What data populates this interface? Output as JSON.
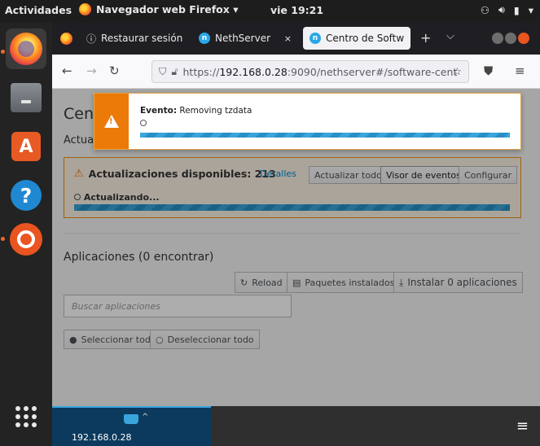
{
  "topbar": {
    "activities": "Actividades",
    "app_menu": "Navegador web Firefox ▾",
    "clock": "vie 19:21",
    "tray_icons": [
      "network-icon",
      "volume-icon",
      "battery-icon",
      "system-menu-chevron-icon"
    ]
  },
  "dock": {
    "apps": [
      "firefox",
      "files",
      "software-store",
      "help",
      "ubuntu-settings"
    ],
    "show_apps": "show-applications-grid-icon"
  },
  "browser": {
    "tabs": [
      {
        "label": "Restaurar sesión",
        "close": "×",
        "icon": "info-icon"
      },
      {
        "label": "NethServer",
        "close": "×",
        "icon": "nethserver-icon"
      },
      {
        "label": "Centro de Softw",
        "close": "×",
        "icon": "nethserver-icon"
      }
    ],
    "new_tab": "+",
    "list_tabs": "⌵",
    "url": {
      "prefix": "https://",
      "host": "192.168.0.28",
      "rest": ":9090/nethserver#/software-cent"
    }
  },
  "page": {
    "title": "Centro de Software",
    "updates_section": "Actualizaciones",
    "updates_panel": {
      "title": "Actualizaciones disponibles: 213",
      "details_link": "Detalles",
      "update_all": "Actualizar todo",
      "event_viewer": "Visor de eventos",
      "configure": "Configurar",
      "progress_label": "Actualizando..."
    },
    "apps_title": "Aplicaciones (0 encontrar)",
    "reload": "Reload",
    "installed_packages": "Paquetes instalados",
    "install_apps": "Instalar 0 aplicaciones",
    "search_placeholder": "Buscar aplicaciones",
    "select_all": "Seleccionar todo",
    "deselect_all": "Deseleccionar todo"
  },
  "toast": {
    "label": "Evento:",
    "message": "Removing tzdata"
  },
  "cockpit": {
    "host": "192.168.0.28"
  },
  "colors": {
    "warning": "#ec7a08",
    "accent": "#39a5dc",
    "ubuntu_orange": "#e95420"
  }
}
